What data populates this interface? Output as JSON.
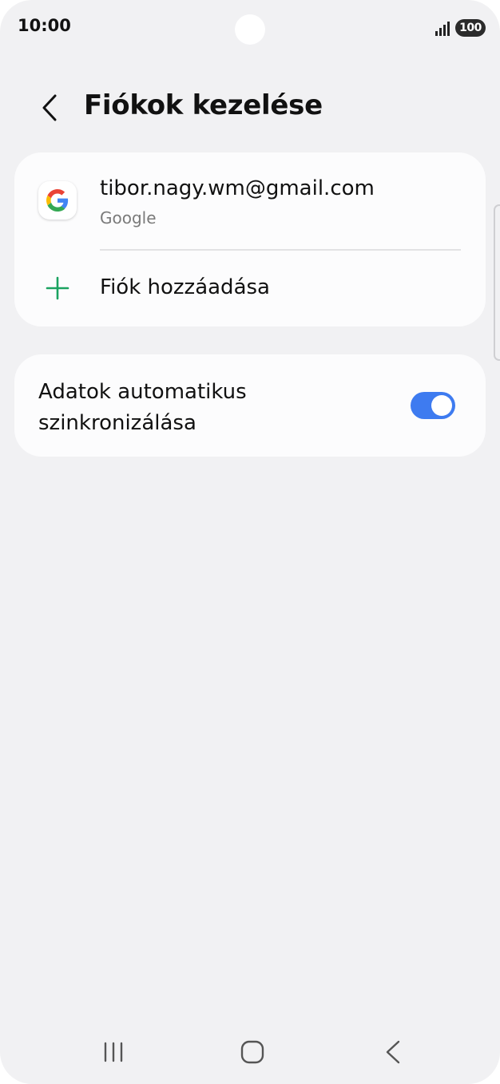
{
  "status_bar": {
    "time": "10:00",
    "battery": "100",
    "icons": [
      "signal-icon",
      "battery-icon",
      "camera-cutout"
    ]
  },
  "header": {
    "title": "Fiókok kezelése",
    "back_icon": "chevron-left-icon"
  },
  "accounts": {
    "items": [
      {
        "email": "tibor.nagy.wm@gmail.com",
        "provider": "Google",
        "icon": "google-logo-icon"
      }
    ],
    "add_label": "Fiók hozzáadása",
    "add_icon": "plus-icon"
  },
  "sync": {
    "label": "Adatok automatikus szinkronizálása",
    "enabled": true
  },
  "nav_bar": {
    "icons": [
      "recent-apps-icon",
      "home-icon",
      "back-icon"
    ]
  },
  "colors": {
    "background": "#f1f1f3",
    "card": "#fcfcfd",
    "toggle_on": "#3e7bf0",
    "plus_accent": "#1aa260",
    "secondary_text": "#7a7a7a"
  }
}
